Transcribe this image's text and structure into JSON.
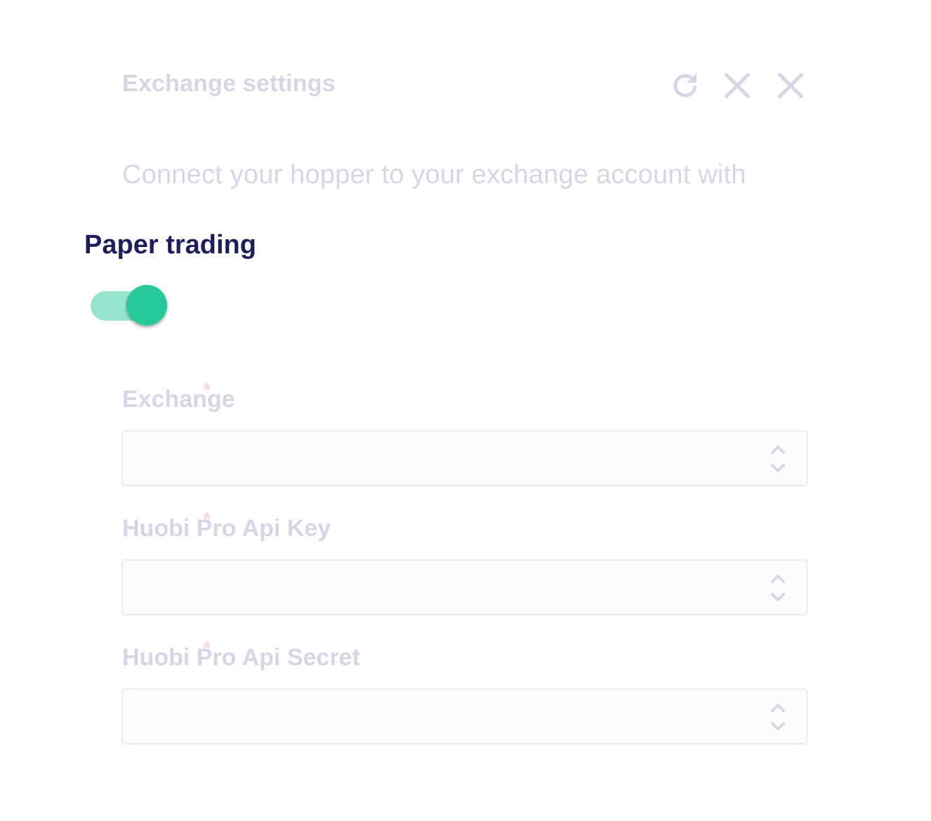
{
  "header": {
    "title": "Exchange settings",
    "icons": [
      "refresh-icon",
      "close-icon",
      "close-icon"
    ]
  },
  "description": "Connect your hopper to your exchange account with",
  "paper_trading": {
    "label": "Paper trading",
    "enabled": true,
    "accent_color": "#27c89a"
  },
  "fields": [
    {
      "label": "Exchange",
      "required_marker": "*",
      "value": ""
    },
    {
      "label": "Huobi Pro Api Key",
      "required_marker": "*",
      "value": ""
    },
    {
      "label": "Huobi Pro Api Secret",
      "required_marker": "*",
      "value": ""
    }
  ],
  "colors": {
    "faded_text": "#d7d6e6",
    "heading": "#1e1e5e",
    "required": "#fbd6d2"
  }
}
